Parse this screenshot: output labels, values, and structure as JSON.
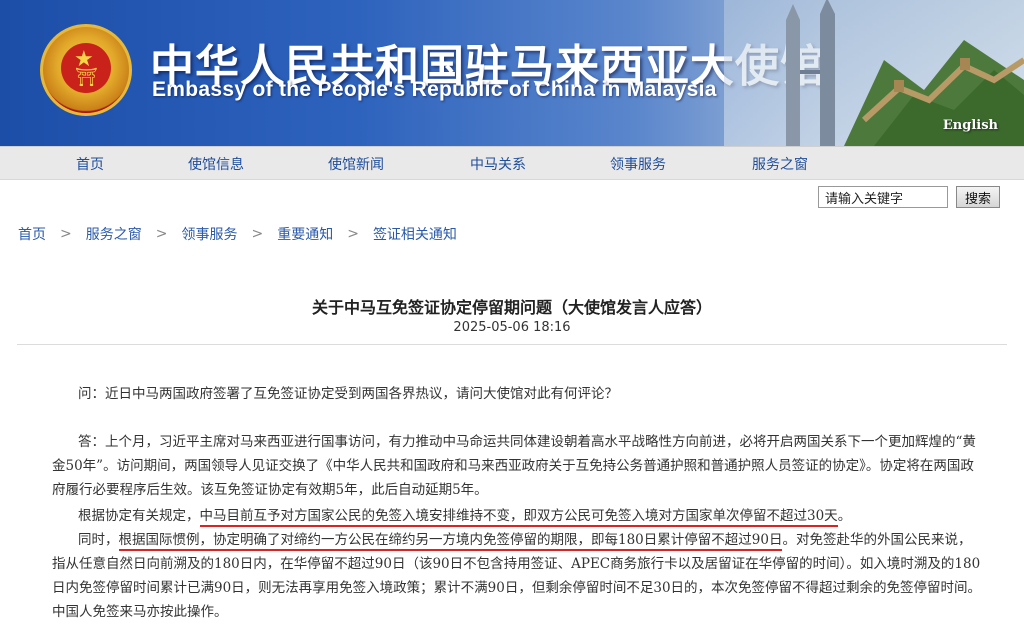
{
  "header": {
    "title_zh": "中华人民共和国驻马来西亚大使馆",
    "title_en": "Embassy of the People's Republic of China in Malaysia",
    "english_link": "English"
  },
  "nav": {
    "items": [
      "首页",
      "使馆信息",
      "使馆新闻",
      "中马关系",
      "领事服务",
      "服务之窗"
    ]
  },
  "search": {
    "placeholder": "请输入关键字",
    "value": "请输入关键字",
    "button_label": "搜索"
  },
  "breadcrumb": {
    "items": [
      "首页",
      "服务之窗",
      "领事服务",
      "重要通知",
      "签证相关通知"
    ],
    "separator": ">"
  },
  "article": {
    "title": "关于中马互免签证协定停留期问题（大使馆发言人应答）",
    "date": "2025-05-06 18:16",
    "question": "问：近日中马两国政府签署了互免签证协定受到两国各界热议，请问大使馆对此有何评论？",
    "answer_1": "答：上个月，习近平主席对马来西亚进行国事访问，有力推动中马命运共同体建设朝着高水平战略性方向前进，必将开启两国关系下一个更加辉煌的“黄金50年”。访问期间，两国领导人见证交换了《中华人民共和国政府和马来西亚政府关于互免持公务普通护照和普通护照人员签证的协定》。协定将在两国政府履行必要程序后生效。该互免签证协定有效期5年，此后自动延期5年。",
    "p2_prefix": "根据协定有关规定，",
    "p2_underlined": "中马目前互予对方国家公民的免签入境安排维持不变，即双方公民可免签入境对方国家单次停留不超过30天",
    "p2_suffix": "。",
    "p3_prefix": "同时，",
    "p3_underlined": "根据国际惯例，协定明确了对缔约一方公民在缔约另一方境内免签停留的期限，即每180日累计停留不超过90日",
    "p3_suffix": "。对免签赴华的外国公民来说，指从任意自然日向前溯及的180日内，在华停留不超过90日（该90日不包含持用签证、APEC商务旅行卡以及居留证在华停留的时间）。如入境时溯及的180日内免签停留时间累计已满90日，则无法再享用免签入境政策；累计不满90日，但剩余停留时间不足30日的，本次免签停留不得超过剩余的免签停留时间。中国人免签来马亦按此操作。"
  },
  "colors": {
    "banner_blue": "#2e63bd",
    "nav_link": "#1f4d9a",
    "underline_red": "#d22222"
  }
}
